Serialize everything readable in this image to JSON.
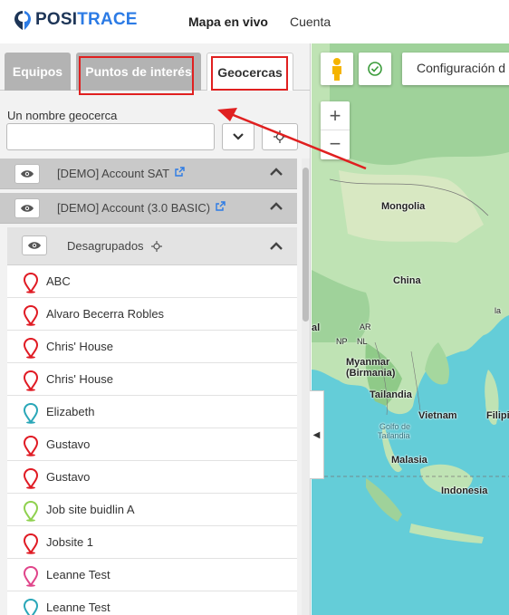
{
  "header": {
    "logo_part1": "POSI",
    "logo_part2": "TRACE",
    "nav": [
      {
        "label": "Mapa en vivo",
        "active": true
      },
      {
        "label": "Cuenta",
        "active": false
      }
    ]
  },
  "tabs": [
    {
      "label": "Equipos",
      "active": false
    },
    {
      "label": "Puntos de interés",
      "active": false
    },
    {
      "label": "Geocercas",
      "active": true
    }
  ],
  "search": {
    "label": "Un nombre geocerca",
    "value": "",
    "placeholder": ""
  },
  "accounts": [
    {
      "name": "[DEMO] Account SAT"
    },
    {
      "name": "[DEMO] Account (3.0 BASIC)"
    }
  ],
  "group": {
    "name": "Desagrupados"
  },
  "items": [
    {
      "label": "ABC",
      "color": "#e01b24"
    },
    {
      "label": "Alvaro Becerra Robles",
      "color": "#e01b24"
    },
    {
      "label": "Chris' House",
      "color": "#e01b24"
    },
    {
      "label": "Chris' House",
      "color": "#e01b24"
    },
    {
      "label": "Elizabeth",
      "color": "#2aa7b8"
    },
    {
      "label": "Gustavo",
      "color": "#e01b24"
    },
    {
      "label": "Gustavo",
      "color": "#e01b24"
    },
    {
      "label": "Job site buidlin A",
      "color": "#8fd14f"
    },
    {
      "label": "Jobsite 1",
      "color": "#e01b24"
    },
    {
      "label": "Leanne Test",
      "color": "#e0458a"
    },
    {
      "label": "Leanne Test",
      "color": "#2aa7b8"
    }
  ],
  "map": {
    "config_label": "Configuración d",
    "zoom_in": "+",
    "zoom_out": "−",
    "labels": {
      "mongolia": "Mongolia",
      "china": "China",
      "myanmar": "Myanmar",
      "birmania": "(Birmania)",
      "tailandia": "Tailandia",
      "vietnam": "Vietnam",
      "golfo1": "Golfo de",
      "golfo2": "Tailandia",
      "malasia": "Malasia",
      "indonesia": "Indonesia",
      "filipinas": "Filipi",
      "al": "al",
      "ar": "AR",
      "np": "NP",
      "nl": "NL",
      "la": "la"
    },
    "collapse_glyph": "◀"
  },
  "colors": {
    "accent_red": "#e02020",
    "tab_inactive": "#b3b3b3",
    "brand_blue": "#2c7be5"
  }
}
